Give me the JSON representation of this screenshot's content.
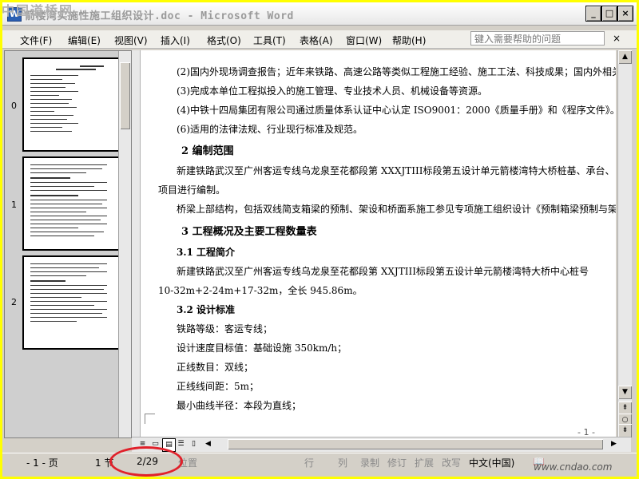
{
  "watermark": {
    "top_left": "中国道桥网",
    "bottom_right": "www.cndao.com"
  },
  "titlebar": {
    "app_icon": "W",
    "title": "箭楼湾实施性施工组织设计.doc - Microsoft Word",
    "buttons": {
      "minimize": "_",
      "maximize": "□",
      "close": "×"
    }
  },
  "menubar": {
    "items": [
      "文件(F)",
      "编辑(E)",
      "视图(V)",
      "插入(I)",
      "格式(O)",
      "工具(T)",
      "表格(A)",
      "窗口(W)",
      "帮助(H)"
    ],
    "help_placeholder": "键入需要帮助的问题",
    "doc_close": "×"
  },
  "thumbnails": {
    "labels": [
      "0",
      "1",
      "2"
    ]
  },
  "document": {
    "lines": [
      "(2)国内外现场调查报告；近年来铁路、高速公路等类似工程施工经验、施工工法、科技成果；国内外相关",
      "(3)完成本单位工程拟投入的施工管理、专业技术人员、机械设备等资源。",
      "(4)中铁十四局集团有限公司通过质量体系认证中心认定 ISO9001：2000《质量手册》和《程序文件》。",
      "(6)适用的法律法规、行业现行标准及规范。",
      "2 编制范围",
      "新建铁路武汉至广州客运专线乌龙泉至花都段第 XXXJTIII标段第五设计单元箭楼湾特大桥桩基、承台、",
      "项目进行编制。",
      "桥梁上部结构，包括双线简支箱梁的预制、架设和桥面系施工参见专项施工组织设计《预制箱梁预制与架",
      "3 工程概况及主要工程数量表",
      "3.1 工程简介",
      "新建铁路武汉至广州客运专线乌龙泉至花都段第 XXJTIII标段第五设计单元箭楼湾特大桥中心桩号",
      "10-32m+2-24m+17-32m，全长 945.86m。",
      "3.2 设计标准",
      "铁路等级：客运专线；",
      "设计速度目标值：基础设施 350km/h；",
      "正线数目：双线；",
      "正线线间距：5m；",
      "最小曲线半径：本段为直线；"
    ],
    "page_number": "- 1 -"
  },
  "statusbar": {
    "page": "- 1 - 页",
    "section": "1 节",
    "page_of": "2/29",
    "position": "位置",
    "line": "行",
    "column": "列",
    "rec": "录制",
    "trk": "修订",
    "ext": "扩展",
    "ovr": "改写",
    "language": "中文(中国)"
  }
}
